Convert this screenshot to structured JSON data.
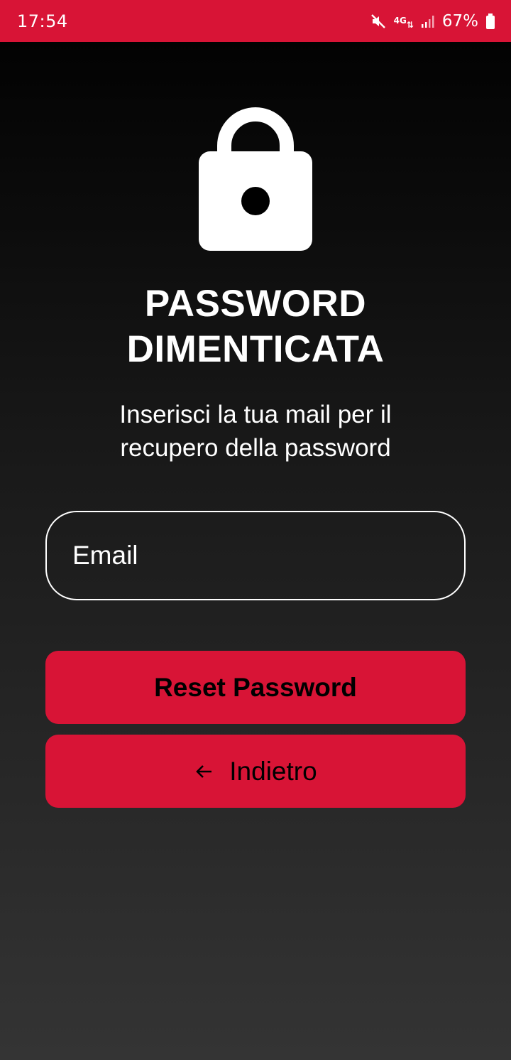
{
  "status_bar": {
    "time": "17:54",
    "network_type": "4G",
    "battery": "67%",
    "background_color": "#d81436"
  },
  "page": {
    "title_line1": "PASSWORD",
    "title_line2": "DIMENTICATA",
    "subtitle_line1": "Inserisci la tua mail per il",
    "subtitle_line2": "recupero della password"
  },
  "form": {
    "email_placeholder": "Email"
  },
  "buttons": {
    "reset_label": "Reset Password",
    "back_label": "Indietro"
  },
  "icons": {
    "hero": "lock-icon",
    "back": "arrow-left-icon",
    "mute": "mute-icon",
    "signal": "signal-icon",
    "battery": "battery-icon"
  },
  "colors": {
    "accent": "#d81436",
    "text": "#ffffff",
    "button_text": "#000000"
  }
}
